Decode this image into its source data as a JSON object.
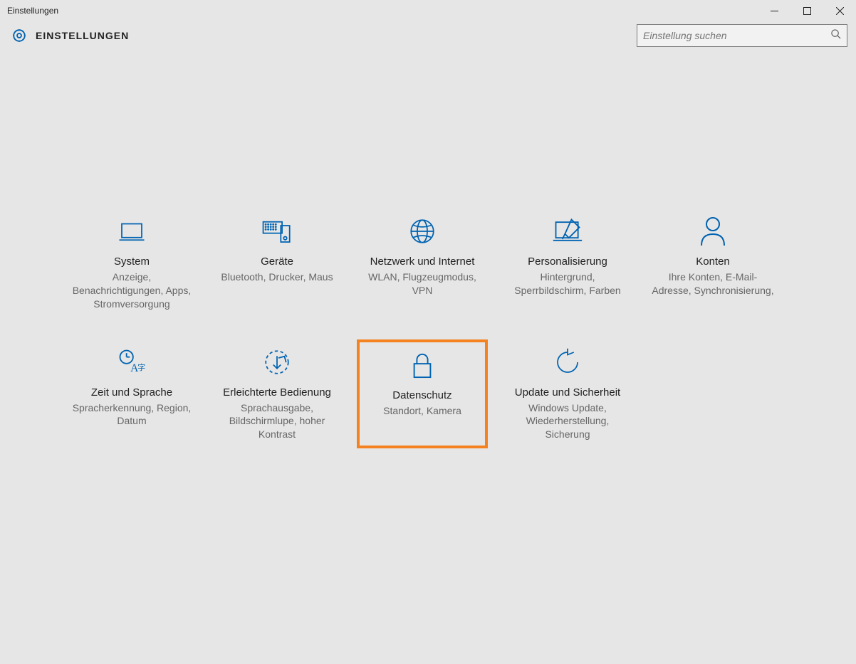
{
  "window": {
    "title": "Einstellungen"
  },
  "header": {
    "title": "EINSTELLUNGEN"
  },
  "search": {
    "placeholder": "Einstellung suchen"
  },
  "tiles": [
    {
      "id": "system",
      "label": "System",
      "desc": "Anzeige, Benachrichtigungen, Apps, Stromversorgung",
      "highlight": false
    },
    {
      "id": "devices",
      "label": "Geräte",
      "desc": "Bluetooth, Drucker, Maus",
      "highlight": false
    },
    {
      "id": "network",
      "label": "Netzwerk und Internet",
      "desc": "WLAN, Flugzeugmodus, VPN",
      "highlight": false
    },
    {
      "id": "personalization",
      "label": "Personalisierung",
      "desc": "Hintergrund, Sperrbildschirm, Farben",
      "highlight": false
    },
    {
      "id": "accounts",
      "label": "Konten",
      "desc": "Ihre Konten, E-Mail-Adresse, Synchronisierung,",
      "highlight": false
    },
    {
      "id": "time-language",
      "label": "Zeit und Sprache",
      "desc": "Spracherkennung, Region, Datum",
      "highlight": false
    },
    {
      "id": "ease-of-access",
      "label": "Erleichterte Bedienung",
      "desc": "Sprachausgabe, Bildschirmlupe, hoher Kontrast",
      "highlight": false
    },
    {
      "id": "privacy",
      "label": "Datenschutz",
      "desc": "Standort, Kamera",
      "highlight": true
    },
    {
      "id": "update-security",
      "label": "Update und Sicherheit",
      "desc": "Windows Update, Wiederherstellung, Sicherung",
      "highlight": false
    }
  ],
  "colors": {
    "accent": "#0063B1",
    "highlight": "#f58220"
  }
}
